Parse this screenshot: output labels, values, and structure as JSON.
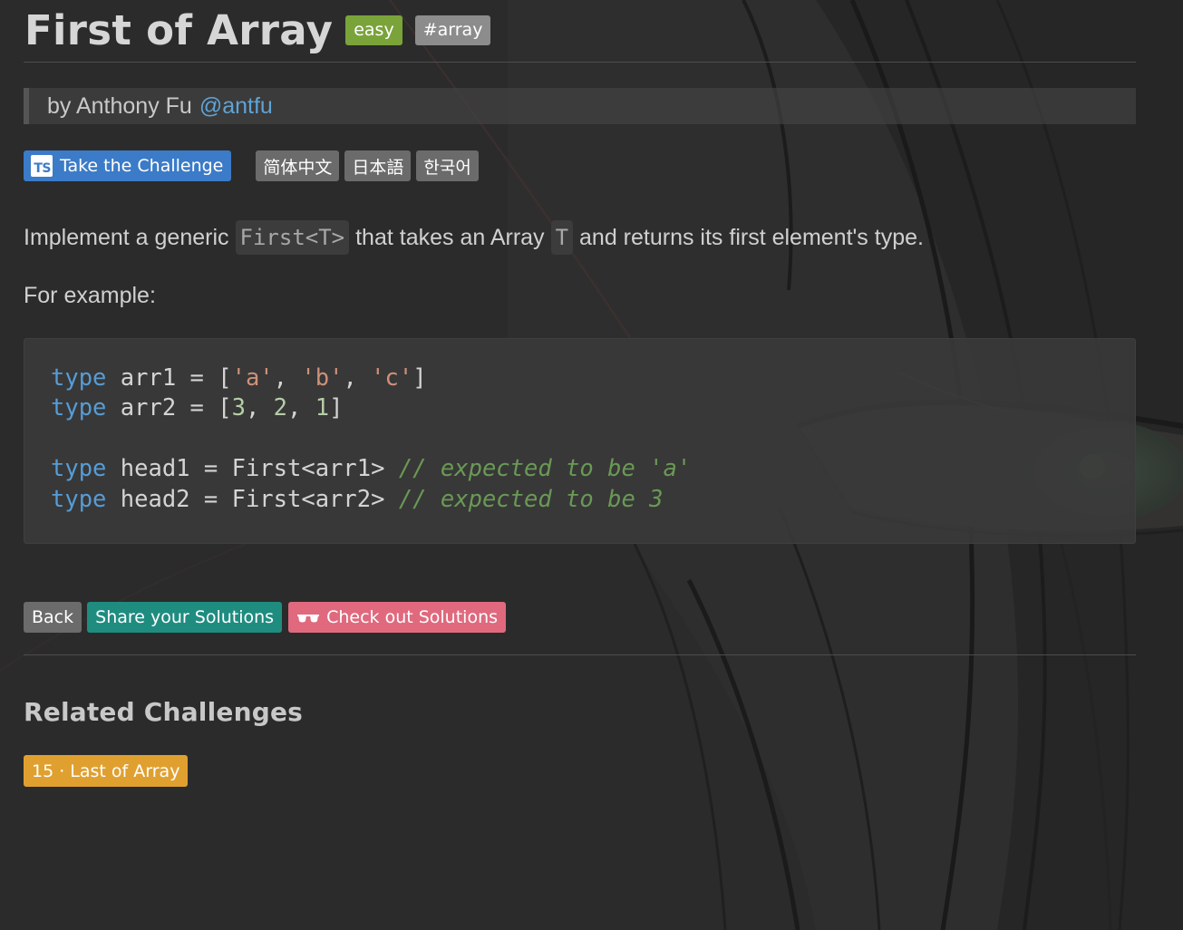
{
  "challenge": {
    "title": "First of Array",
    "difficulty": "easy",
    "tag": "#array",
    "author_prefix": "by Anthony Fu",
    "author_handle": "@antfu"
  },
  "actions_top": {
    "take_challenge_icon": "TS",
    "take_challenge_label": "Take the Challenge",
    "languages": [
      "简体中文",
      "日本語",
      "한국어"
    ]
  },
  "description": {
    "part1": "Implement a generic",
    "code1": "First<T>",
    "part2": "that takes an Array",
    "code2": "T",
    "part3": "and returns its first element's type.",
    "example_label": "For example:"
  },
  "code_example": {
    "line1": {
      "kw": "type",
      "rest": " arr1 = [",
      "s1": "'a'",
      "c1": ", ",
      "s2": "'b'",
      "c2": ", ",
      "s3": "'c'",
      "end": "]"
    },
    "line2": {
      "kw": "type",
      "rest": " arr2 = [",
      "n1": "3",
      "c1": ", ",
      "n2": "2",
      "c2": ", ",
      "n3": "1",
      "end": "]"
    },
    "line4": {
      "kw": "type",
      "rest": " head1 = First<arr1> ",
      "comment": "// expected to be 'a'"
    },
    "line5": {
      "kw": "type",
      "rest": " head2 = First<arr2> ",
      "comment": "// expected to be 3"
    }
  },
  "actions_bottom": {
    "back_label": "Back",
    "share_label": "Share your Solutions",
    "check_label": "Check out Solutions",
    "check_icon": "glasses-icon"
  },
  "related": {
    "title": "Related Challenges",
    "items": [
      {
        "label": "15 · Last of Array"
      }
    ]
  },
  "colors": {
    "background": "#2b2b2b",
    "easy": "#7aa33a",
    "tag": "#8c8c8c",
    "challenge_button": "#3b7bc8",
    "share_button": "#1f8c80",
    "check_button": "#e0697e",
    "related_button": "#e0a030",
    "link": "#5fa3d6"
  }
}
